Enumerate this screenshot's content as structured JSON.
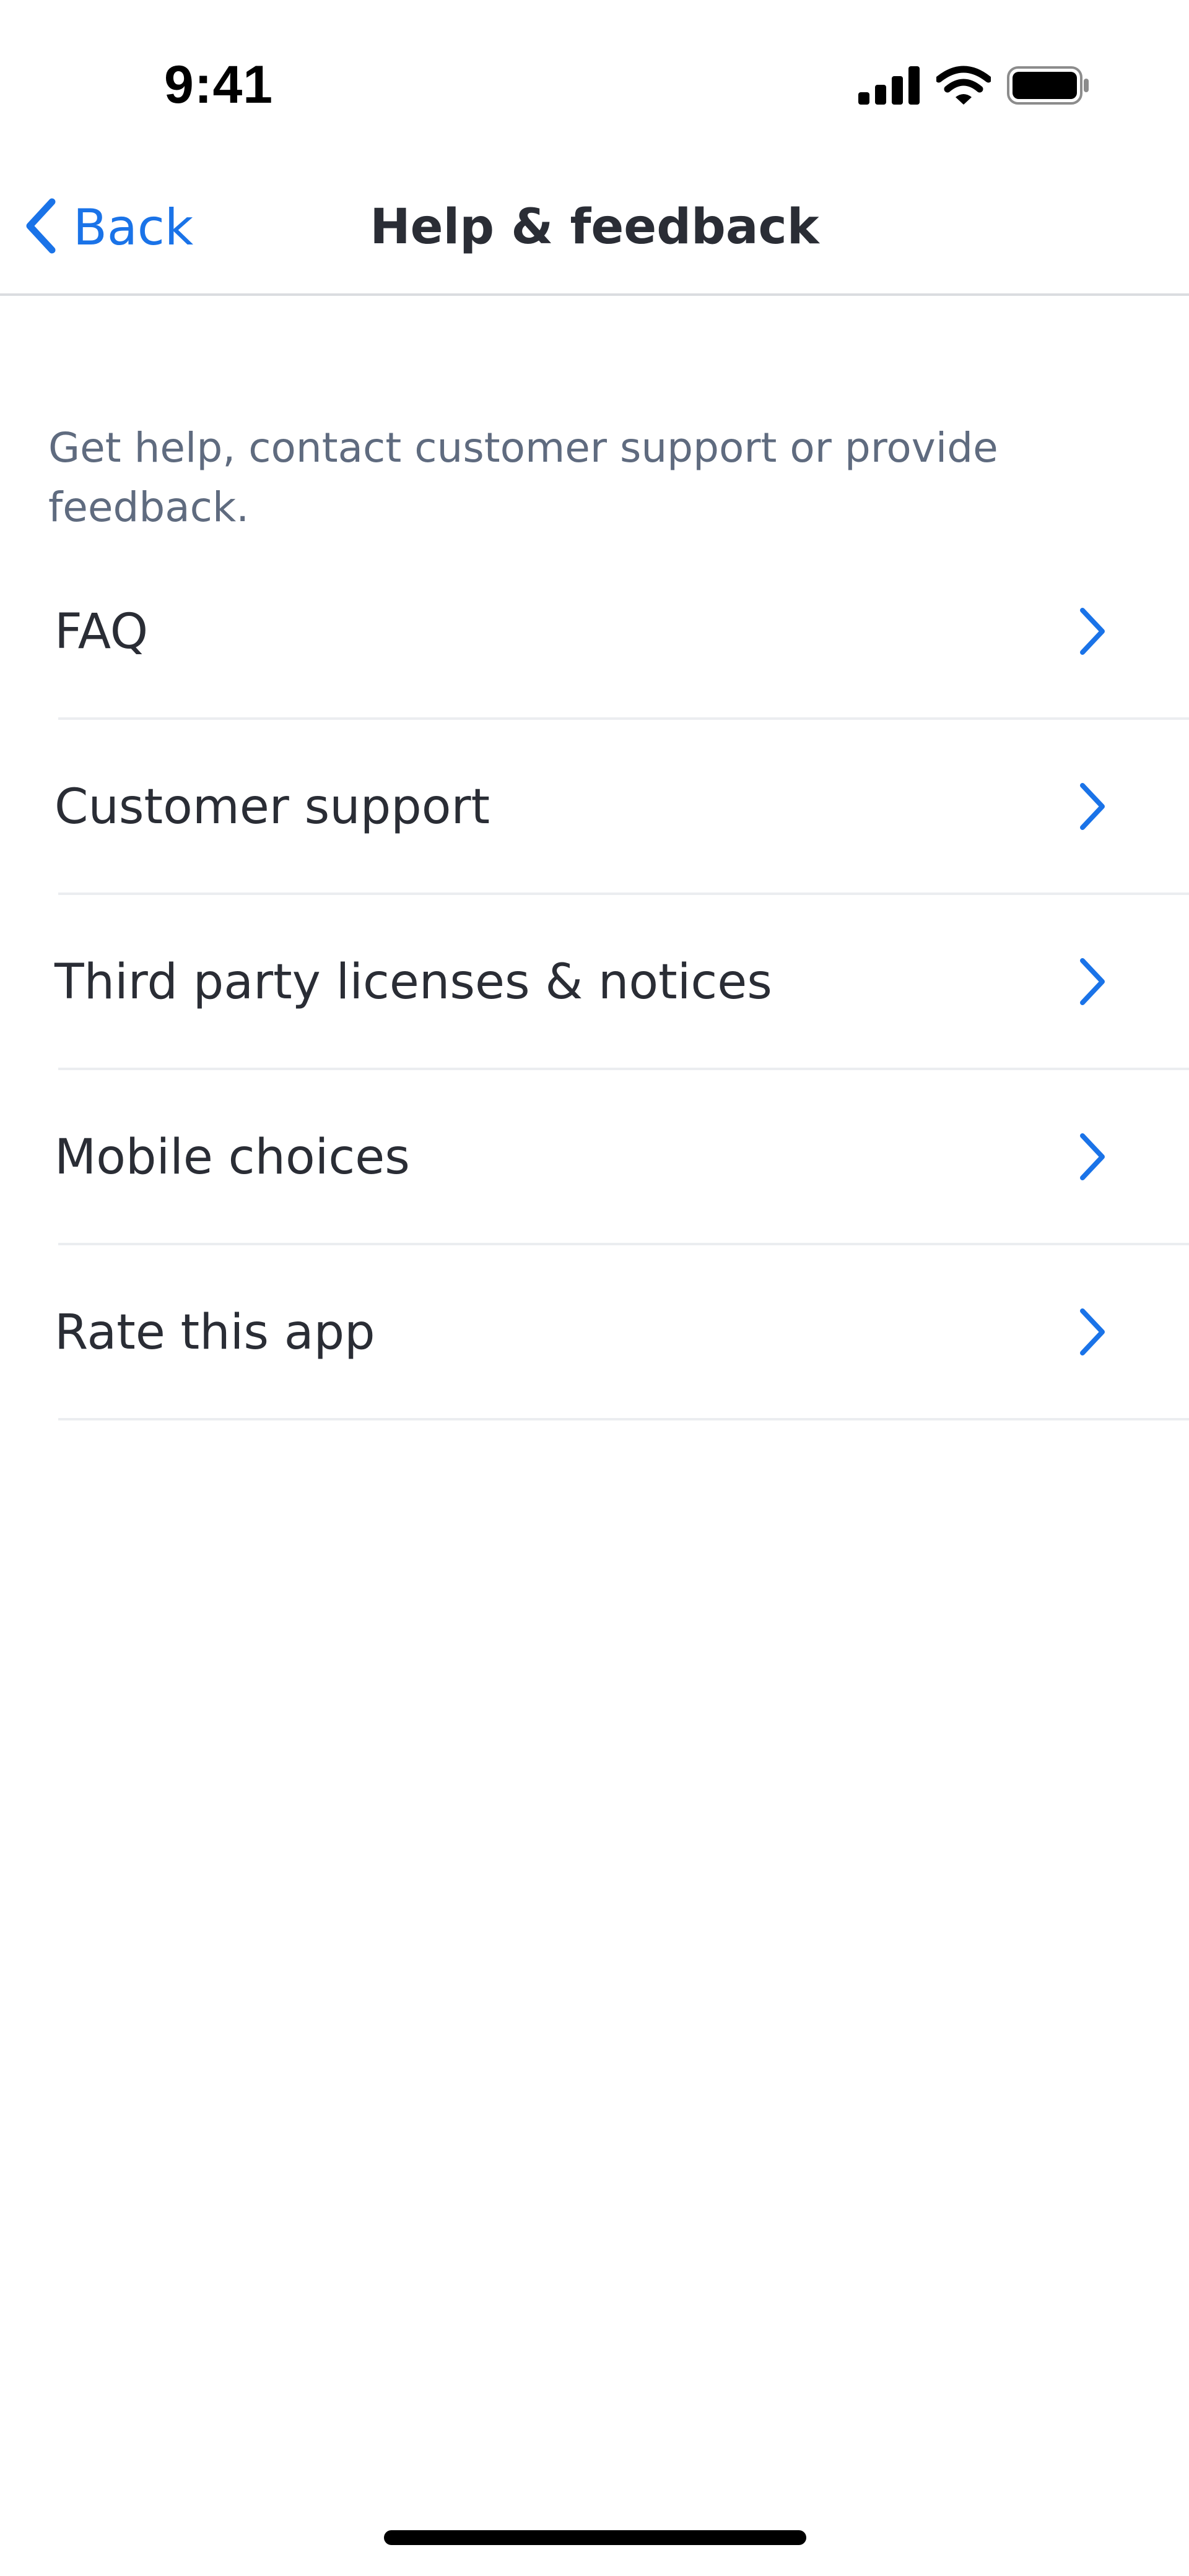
{
  "status_bar": {
    "time": "9:41",
    "icons": [
      "cellular-signal-icon",
      "wifi-icon",
      "battery-icon"
    ]
  },
  "nav": {
    "back_label": "Back",
    "title": "Help & feedback",
    "back_icon": "chevron-left-icon"
  },
  "description": "Get help, contact customer support or provide feedback.",
  "menu": {
    "items": [
      {
        "label": "FAQ",
        "icon": "chevron-right-icon"
      },
      {
        "label": "Customer support",
        "icon": "chevron-right-icon"
      },
      {
        "label": "Third party licenses & notices",
        "icon": "chevron-right-icon"
      },
      {
        "label": "Mobile choices",
        "icon": "chevron-right-icon"
      },
      {
        "label": "Rate this app",
        "icon": "chevron-right-icon"
      }
    ]
  },
  "colors": {
    "accent": "#1a73e8",
    "text_primary": "#2a2d35",
    "text_secondary": "#5f6b7f",
    "divider": "#ebedf0"
  }
}
